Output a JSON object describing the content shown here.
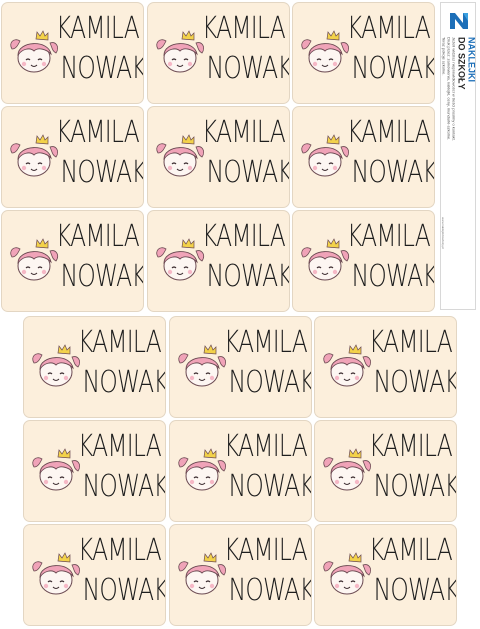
{
  "sticker": {
    "first_name": "KAMILA",
    "last_name": "NOWAK"
  },
  "brand": {
    "name_top": "NAKLEJKI",
    "name_bottom": "DO SZKOŁY",
    "note_1": "Jeżeli widzisz nieprawidłowości w treści prosimy o kontakt.",
    "note_2": "Druk przez: zamówienia, naklejki, ceny, mundurki-szkolne.",
    "note_3": "Teraz pokoje szkolne.",
    "url": "www.naklejkidoszkoly.pl"
  },
  "colors": {
    "sticker_bg": "#fcefdc",
    "sticker_border": "#e3d6c3",
    "hair": "#f0a3b8",
    "crown": "#f3d24a",
    "text": "#1e1e1e",
    "brand_blue": "#1d6fb8"
  },
  "icons": [
    "princess-face-icon",
    "crown-icon",
    "brand-logo-icon"
  ]
}
